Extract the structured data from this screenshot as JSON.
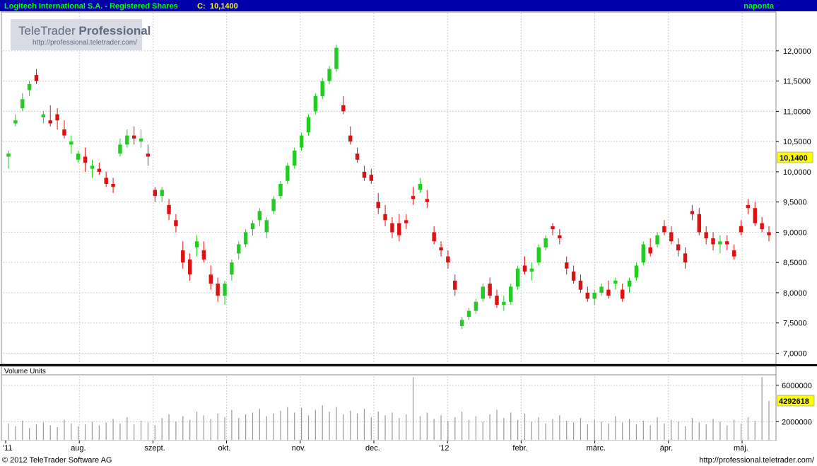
{
  "header": {
    "title": "Logitech International S.A. - Registered Shares",
    "close_label": "C:",
    "close_value": "10,1400",
    "period": "naponta"
  },
  "watermark": {
    "brand_regular": "TeleTrader",
    "brand_bold": "Professional",
    "url": "http://professional.teletrader.com/"
  },
  "footer": {
    "copyright": "© 2012 TeleTrader Software AG",
    "url": "http://professional.teletrader.com/"
  },
  "colors": {
    "up": "#22cc22",
    "down": "#dd1111",
    "header_bg": "#0000aa",
    "header_text": "#ffff00",
    "last_value_bg": "#ffff00",
    "volume_bar": "#999999"
  },
  "chart_data": [
    {
      "type": "candlestick",
      "panel": "price",
      "y_ticks": [
        "12,0000",
        "11,5000",
        "11,0000",
        "10,5000",
        "10,0000",
        "9,5000",
        "9,0000",
        "8,5000",
        "8,0000",
        "7,5000",
        "7,0000"
      ],
      "ylim": [
        6.83,
        12.63
      ],
      "last_value_label": "10,1400",
      "last_value": 10.14,
      "x_ticks": [
        "'11",
        "aug.",
        "szept.",
        "okt.",
        "nov.",
        "dec.",
        "'12",
        "febr.",
        "márc.",
        "ápr.",
        "máj."
      ],
      "grid": true,
      "ohlc": [
        [
          10.25,
          10.35,
          10.05,
          10.3
        ],
        [
          10.8,
          10.95,
          10.75,
          10.85
        ],
        [
          11.05,
          11.3,
          11.0,
          11.2
        ],
        [
          11.35,
          11.5,
          11.25,
          11.45
        ],
        [
          11.6,
          11.7,
          11.45,
          11.5
        ],
        [
          10.9,
          11.0,
          10.8,
          10.95
        ],
        [
          10.85,
          11.1,
          10.75,
          10.8
        ],
        [
          10.95,
          11.05,
          10.7,
          10.85
        ],
        [
          10.7,
          10.85,
          10.55,
          10.6
        ],
        [
          10.45,
          10.6,
          10.3,
          10.5
        ],
        [
          10.2,
          10.35,
          10.15,
          10.3
        ],
        [
          10.25,
          10.4,
          10.0,
          10.15
        ],
        [
          10.05,
          10.2,
          9.9,
          10.1
        ],
        [
          10.05,
          10.15,
          9.95,
          10.0
        ],
        [
          9.9,
          10.0,
          9.75,
          9.8
        ],
        [
          9.8,
          9.9,
          9.65,
          9.75
        ],
        [
          10.3,
          10.55,
          10.25,
          10.45
        ],
        [
          10.45,
          10.7,
          10.4,
          10.6
        ],
        [
          10.6,
          10.75,
          10.45,
          10.55
        ],
        [
          10.5,
          10.7,
          10.4,
          10.55
        ],
        [
          10.3,
          10.45,
          10.1,
          10.25
        ],
        [
          9.7,
          9.75,
          9.5,
          9.6
        ],
        [
          9.6,
          9.75,
          9.5,
          9.7
        ],
        [
          9.45,
          9.55,
          9.2,
          9.3
        ],
        [
          9.2,
          9.3,
          9.0,
          9.1
        ],
        [
          8.7,
          8.85,
          8.4,
          8.5
        ],
        [
          8.55,
          8.65,
          8.2,
          8.3
        ],
        [
          8.75,
          8.95,
          8.6,
          8.85
        ],
        [
          8.7,
          8.85,
          8.5,
          8.55
        ],
        [
          8.3,
          8.45,
          8.05,
          8.15
        ],
        [
          8.15,
          8.25,
          7.85,
          7.95
        ],
        [
          7.95,
          8.2,
          7.8,
          8.15
        ],
        [
          8.3,
          8.55,
          8.2,
          8.5
        ],
        [
          8.65,
          8.85,
          8.55,
          8.8
        ],
        [
          8.8,
          9.05,
          8.75,
          9.0
        ],
        [
          9.05,
          9.2,
          8.95,
          9.15
        ],
        [
          9.2,
          9.4,
          9.1,
          9.35
        ],
        [
          9.0,
          9.25,
          8.9,
          9.2
        ],
        [
          9.35,
          9.6,
          9.3,
          9.55
        ],
        [
          9.6,
          9.85,
          9.55,
          9.8
        ],
        [
          9.85,
          10.15,
          9.8,
          10.1
        ],
        [
          10.1,
          10.4,
          10.05,
          10.35
        ],
        [
          10.4,
          10.65,
          10.35,
          10.6
        ],
        [
          10.65,
          10.95,
          10.6,
          10.9
        ],
        [
          11.0,
          11.3,
          10.95,
          11.25
        ],
        [
          11.25,
          11.55,
          11.2,
          11.5
        ],
        [
          11.5,
          11.75,
          11.45,
          11.7
        ],
        [
          11.7,
          12.1,
          11.65,
          12.05
        ],
        [
          11.1,
          11.25,
          10.95,
          11.0
        ],
        [
          10.6,
          10.75,
          10.45,
          10.5
        ],
        [
          10.3,
          10.4,
          10.15,
          10.2
        ],
        [
          10.0,
          10.1,
          9.85,
          9.9
        ],
        [
          9.95,
          10.05,
          9.8,
          9.85
        ],
        [
          9.5,
          9.65,
          9.3,
          9.4
        ],
        [
          9.3,
          9.45,
          9.1,
          9.2
        ],
        [
          9.15,
          9.25,
          8.9,
          9.0
        ],
        [
          9.15,
          9.3,
          8.85,
          8.95
        ],
        [
          9.2,
          9.3,
          9.05,
          9.15
        ],
        [
          9.6,
          9.75,
          9.45,
          9.55
        ],
        [
          9.7,
          9.9,
          9.65,
          9.8
        ],
        [
          9.55,
          9.7,
          9.4,
          9.5
        ],
        [
          9.0,
          9.1,
          8.8,
          8.85
        ],
        [
          8.75,
          8.85,
          8.6,
          8.7
        ],
        [
          8.6,
          8.7,
          8.4,
          8.5
        ],
        [
          8.2,
          8.3,
          7.95,
          8.05
        ],
        [
          7.45,
          7.6,
          7.4,
          7.55
        ],
        [
          7.6,
          7.75,
          7.55,
          7.7
        ],
        [
          7.7,
          7.9,
          7.65,
          7.85
        ],
        [
          7.9,
          8.15,
          7.85,
          8.1
        ],
        [
          8.15,
          8.25,
          7.9,
          7.95
        ],
        [
          7.95,
          8.05,
          7.75,
          7.8
        ],
        [
          7.8,
          7.95,
          7.7,
          7.85
        ],
        [
          7.85,
          8.15,
          7.8,
          8.1
        ],
        [
          8.1,
          8.45,
          8.05,
          8.4
        ],
        [
          8.45,
          8.6,
          8.3,
          8.35
        ],
        [
          8.35,
          8.5,
          8.2,
          8.4
        ],
        [
          8.5,
          8.8,
          8.45,
          8.75
        ],
        [
          8.75,
          8.95,
          8.7,
          8.9
        ],
        [
          9.1,
          9.15,
          8.95,
          9.05
        ],
        [
          8.95,
          9.05,
          8.8,
          8.9
        ],
        [
          8.5,
          8.6,
          8.3,
          8.4
        ],
        [
          8.35,
          8.45,
          8.15,
          8.2
        ],
        [
          8.2,
          8.3,
          8.0,
          8.05
        ],
        [
          8.0,
          8.1,
          7.85,
          7.9
        ],
        [
          7.9,
          8.05,
          7.8,
          8.0
        ],
        [
          8.0,
          8.15,
          7.95,
          8.1
        ],
        [
          8.05,
          8.2,
          7.9,
          7.95
        ],
        [
          8.15,
          8.25,
          8.05,
          8.2
        ],
        [
          8.05,
          8.15,
          7.85,
          7.9
        ],
        [
          8.1,
          8.25,
          8.0,
          8.2
        ],
        [
          8.25,
          8.5,
          8.2,
          8.45
        ],
        [
          8.5,
          8.85,
          8.45,
          8.8
        ],
        [
          8.75,
          8.9,
          8.6,
          8.65
        ],
        [
          8.8,
          9.0,
          8.75,
          8.95
        ],
        [
          9.1,
          9.2,
          8.95,
          9.0
        ],
        [
          9.0,
          9.1,
          8.8,
          8.85
        ],
        [
          8.8,
          8.9,
          8.6,
          8.7
        ],
        [
          8.65,
          8.75,
          8.4,
          8.5
        ],
        [
          9.35,
          9.45,
          9.2,
          9.3
        ],
        [
          9.3,
          9.4,
          8.95,
          9.0
        ],
        [
          9.0,
          9.1,
          8.8,
          8.9
        ],
        [
          8.9,
          9.0,
          8.7,
          8.8
        ],
        [
          8.8,
          8.95,
          8.65,
          8.85
        ],
        [
          8.85,
          8.95,
          8.7,
          8.8
        ],
        [
          8.7,
          8.8,
          8.55,
          8.6
        ],
        [
          9.1,
          9.2,
          8.95,
          9.0
        ],
        [
          9.45,
          9.55,
          9.3,
          9.4
        ],
        [
          9.4,
          9.5,
          9.1,
          9.15
        ],
        [
          9.15,
          9.25,
          9.0,
          9.05
        ],
        [
          9.0,
          9.1,
          8.85,
          8.95
        ]
      ]
    },
    {
      "type": "bar",
      "panel": "volume",
      "title": "Volume Units",
      "y_ticks": [
        "6000000",
        "2000000"
      ],
      "ylim": [
        0,
        7000000
      ],
      "last_value_label": "4292618",
      "last_value": 4292618,
      "values": [
        1800000,
        1500000,
        2100000,
        1300000,
        1700000,
        1900000,
        1600000,
        1400000,
        2200000,
        1800000,
        1500000,
        1700000,
        2000000,
        1600000,
        1900000,
        2300000,
        1800000,
        2500000,
        1700000,
        2100000,
        1900000,
        1600000,
        2400000,
        2800000,
        2000000,
        2600000,
        2200000,
        3100000,
        2700000,
        2300000,
        2900000,
        2500000,
        3300000,
        2400000,
        2800000,
        3000000,
        3400000,
        2600000,
        2900000,
        3200000,
        3600000,
        3000000,
        3500000,
        2700000,
        3300000,
        3800000,
        3100000,
        3600000,
        2800000,
        3200000,
        2900000,
        3400000,
        2500000,
        3100000,
        2700000,
        3000000,
        2400000,
        2800000,
        6900000,
        2600000,
        3000000,
        2300000,
        2700000,
        2100000,
        2500000,
        3100000,
        2200000,
        2600000,
        2000000,
        2800000,
        3300000,
        2400000,
        3000000,
        2200000,
        2900000,
        2000000,
        2500000,
        1800000,
        2300000,
        2700000,
        2100000,
        1900000,
        2400000,
        1700000,
        2200000,
        2000000,
        1800000,
        2600000,
        1900000,
        2300000,
        1700000,
        2100000,
        1600000,
        2500000,
        1800000,
        2200000,
        2000000,
        1500000,
        2400000,
        1900000,
        1700000,
        2300000,
        2000000,
        1600000,
        2200000,
        1800000,
        2500000,
        2100000,
        6900000,
        4292618
      ]
    }
  ]
}
